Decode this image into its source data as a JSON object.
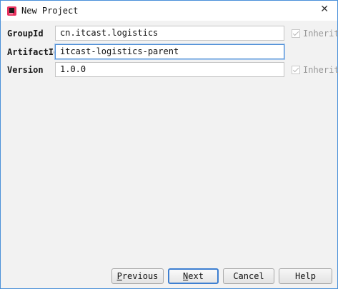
{
  "window": {
    "title": "New Project",
    "close_glyph": "✕"
  },
  "form": {
    "group_id": {
      "label": "GroupId",
      "value": "cn.itcast.logistics",
      "inherit_label": "Inherit",
      "inherit_checked": true
    },
    "artifact_id": {
      "label": "ArtifactId",
      "value": "itcast-logistics-parent"
    },
    "version": {
      "label": "Version",
      "value": "1.0.0",
      "inherit_label": "Inherit",
      "inherit_checked": true
    }
  },
  "buttons": {
    "previous": {
      "mnemonic": "P",
      "rest": "revious"
    },
    "next": {
      "mnemonic": "N",
      "rest": "ext"
    },
    "cancel": "Cancel",
    "help": "Help"
  },
  "colors": {
    "focus_border": "#4f8ed6",
    "window_bg": "#f2f2f2",
    "disabled_text": "#9a9a9a"
  },
  "icons": {
    "app": "intellij-idea-icon",
    "close": "close-icon",
    "check": "check-icon"
  }
}
